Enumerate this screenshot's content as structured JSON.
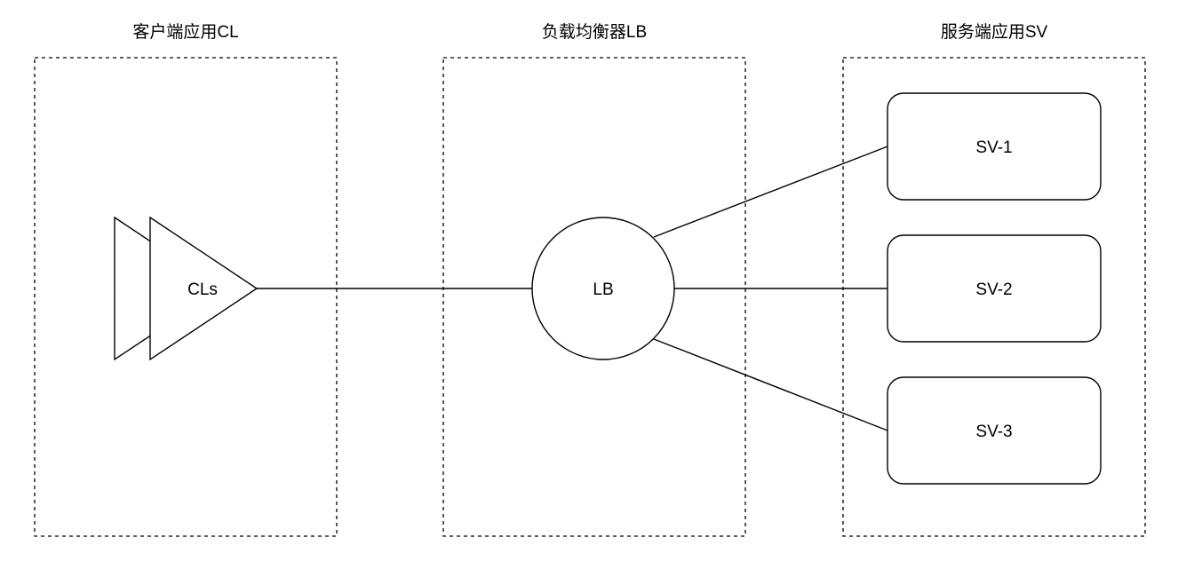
{
  "groups": {
    "client": {
      "title": "客户端应用CL"
    },
    "balancer": {
      "title": "负载均衡器LB"
    },
    "server": {
      "title": "服务端应用SV"
    }
  },
  "nodes": {
    "clients": {
      "label": "CLs"
    },
    "lb": {
      "label": "LB"
    },
    "sv1": {
      "label": "SV-1"
    },
    "sv2": {
      "label": "SV-2"
    },
    "sv3": {
      "label": "SV-3"
    }
  },
  "colors": {
    "stroke": "#000000",
    "background": "#ffffff"
  }
}
